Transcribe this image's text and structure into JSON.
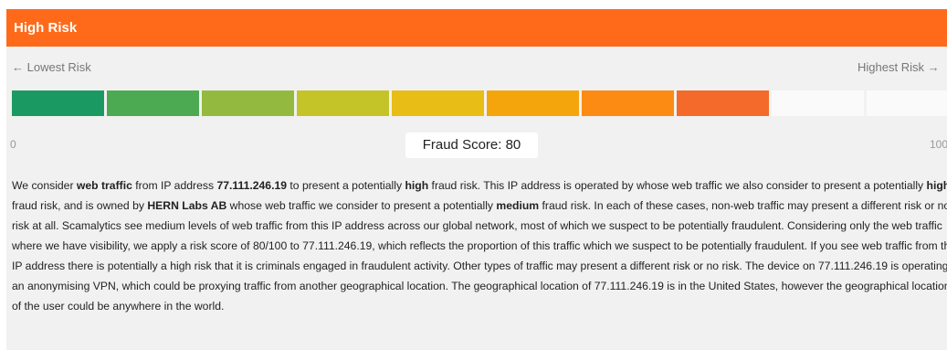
{
  "header": {
    "title": "High Risk"
  },
  "risk_scale": {
    "lowest_label": "← Lowest Risk",
    "highest_label": "Highest Risk →",
    "min_label": "0",
    "max_label": "100",
    "score_label": "Fraud Score: 80",
    "score_value": 80,
    "segment_colors": [
      "#1a9a62",
      "#4caa53",
      "#93ba3f",
      "#c4c428",
      "#e8bd16",
      "#f5a50c",
      "#fb8b12",
      "#f36a2a",
      "#fafafa",
      "#fafafa"
    ]
  },
  "description": {
    "p1": "We consider ",
    "b1": "web traffic",
    "p2": " from IP address ",
    "b2": "77.111.246.19",
    "p3": " to present a potentially ",
    "b3": "high",
    "p4": " fraud risk. This IP address is operated by whose web traffic we also consider to present a potentially ",
    "b4": "high",
    "p5": " fraud risk, and is owned by ",
    "b5": "HERN Labs AB",
    "p6": " whose web traffic we consider to present a potentially ",
    "b6": "medium",
    "p7": " fraud risk. In each of these cases, non-web traffic may present a different risk or no risk at all. Scamalytics see medium levels of web traffic from this IP address across our global network, most of which we suspect to be potentially fraudulent. Considering only the web traffic where we have visibility, we apply a risk score of 80/100 to 77.111.246.19, which reflects the proportion of this traffic which we suspect to be potentially fraudulent. If you see web traffic from this IP address there is potentially a high risk that it is criminals engaged in fraudulent activity. Other types of traffic may present a different risk or no risk. The device on 77.111.246.19 is operating an anonymising VPN, which could be proxying traffic from another geographical location. The geographical location of 77.111.246.19 is in the United States, however the geographical location of the user could be anywhere in the world."
  }
}
